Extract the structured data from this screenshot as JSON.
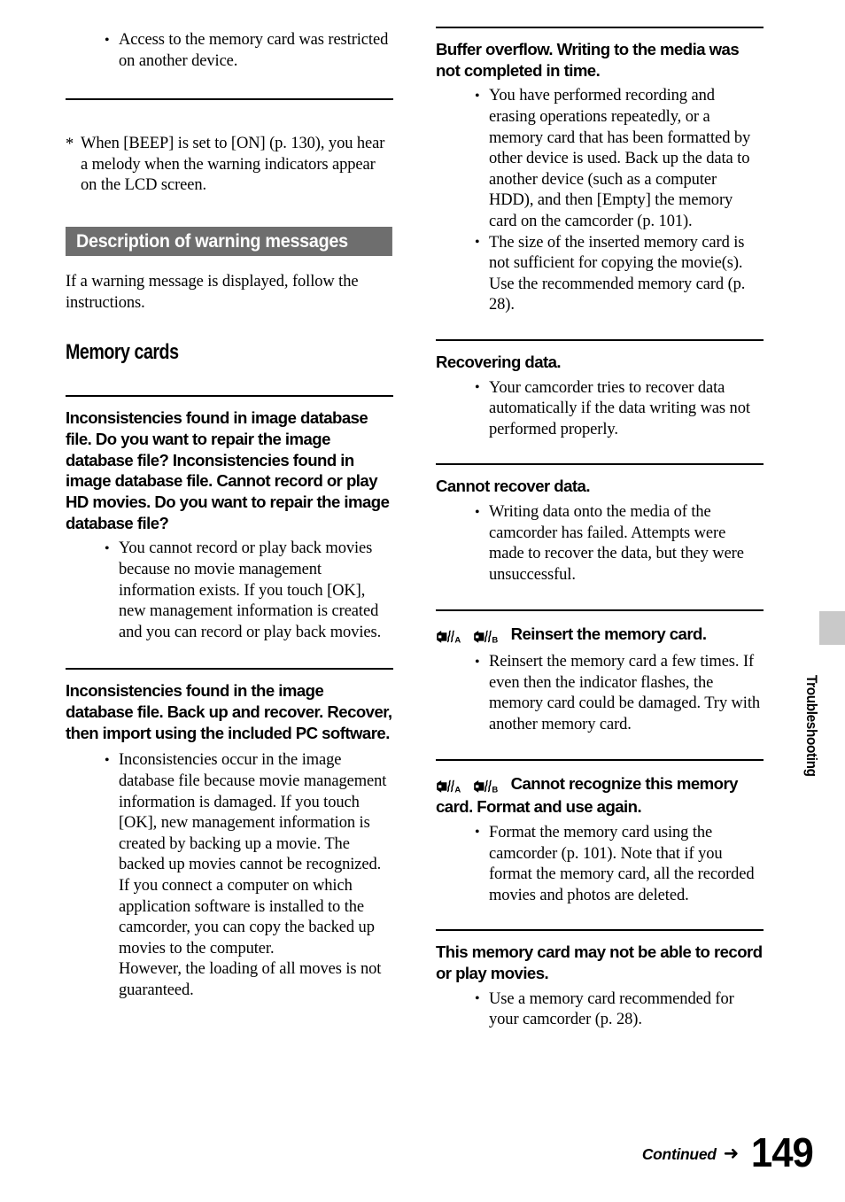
{
  "page": {
    "number": "149",
    "continued_label": "Continued",
    "continued_arrow": "➜",
    "side_tab_label": "Troubleshooting",
    "tab_color": "#c9c9c9",
    "section_bar_color": "#6e6e6e"
  },
  "left_column": {
    "top_bullets": [
      "Access to the memory card was restricted on another device."
    ],
    "footnote": "When [BEEP] is set to [ON] (p. 130), you hear a melody when the warning indicators appear on the LCD screen.",
    "section_title": "Description of warning messages",
    "intro": "If a warning message is displayed, follow the instructions.",
    "subsection_title": "Memory cards",
    "entries": [
      {
        "indicators": [],
        "heading": "Inconsistencies found in image database file. Do you want to repair the image database file? Inconsistencies found in image database file. Cannot record or play HD movies. Do you want to repair the image database file?",
        "bullets": [
          "You cannot record or play back movies because no movie management information exists. If you touch [OK], new management information is created and you can record or play back movies."
        ]
      },
      {
        "indicators": [],
        "heading": "Inconsistencies found in the image database file. Back up and recover. Recover, then import using the included PC software.",
        "bullets": [
          "Inconsistencies occur in the image database file because movie management information is damaged. If you touch [OK], new management information is created by backing up a movie. The backed up movies cannot be recognized.\nIf you connect a computer on which application software is installed to the camcorder, you can copy the backed up movies to the computer.\nHowever, the loading of all moves is not guaranteed."
        ]
      }
    ]
  },
  "right_column": {
    "entries": [
      {
        "indicators": [],
        "heading": "Buffer overflow. Writing to the media was not completed in time.",
        "bullets": [
          "You have performed recording and erasing operations repeatedly, or a memory card that has been formatted by other device is used. Back up the data to another device (such as a computer HDD), and then [Empty] the memory card on the camcorder (p. 101).",
          "The size of the inserted memory card is not sufficient for copying the movie(s). Use the recommended memory card (p. 28)."
        ]
      },
      {
        "indicators": [],
        "heading": "Recovering data.",
        "bullets": [
          "Your camcorder tries to recover data automatically if the data writing was not performed properly."
        ]
      },
      {
        "indicators": [],
        "heading": "Cannot recover data.",
        "bullets": [
          "Writing data onto the media of the camcorder has failed. Attempts were made to recover the data, but they were unsuccessful."
        ]
      },
      {
        "indicators": [
          "A",
          "B"
        ],
        "heading": "Reinsert the memory card.",
        "bullets": [
          "Reinsert the memory card a few times. If even then the indicator flashes, the memory card could be damaged. Try with another memory card."
        ]
      },
      {
        "indicators": [
          "A",
          "B"
        ],
        "heading": "Cannot recognize this memory card. Format and use again.",
        "bullets": [
          "Format the memory card using the camcorder (p. 101). Note that if you format the memory card, all the recorded movies and photos are deleted."
        ]
      },
      {
        "indicators": [],
        "heading": "This memory card may not be able to record or play movies.",
        "bullets": [
          "Use a memory card recommended for your camcorder (p. 28)."
        ]
      }
    ]
  }
}
